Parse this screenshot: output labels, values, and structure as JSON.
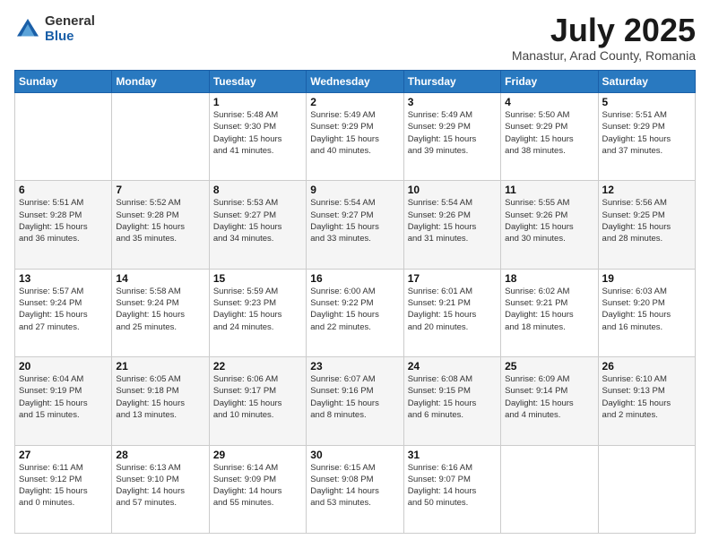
{
  "logo": {
    "general": "General",
    "blue": "Blue"
  },
  "title": "July 2025",
  "location": "Manastur, Arad County, Romania",
  "days_header": [
    "Sunday",
    "Monday",
    "Tuesday",
    "Wednesday",
    "Thursday",
    "Friday",
    "Saturday"
  ],
  "weeks": [
    [
      {
        "day": "",
        "info": ""
      },
      {
        "day": "",
        "info": ""
      },
      {
        "day": "1",
        "info": "Sunrise: 5:48 AM\nSunset: 9:30 PM\nDaylight: 15 hours\nand 41 minutes."
      },
      {
        "day": "2",
        "info": "Sunrise: 5:49 AM\nSunset: 9:29 PM\nDaylight: 15 hours\nand 40 minutes."
      },
      {
        "day": "3",
        "info": "Sunrise: 5:49 AM\nSunset: 9:29 PM\nDaylight: 15 hours\nand 39 minutes."
      },
      {
        "day": "4",
        "info": "Sunrise: 5:50 AM\nSunset: 9:29 PM\nDaylight: 15 hours\nand 38 minutes."
      },
      {
        "day": "5",
        "info": "Sunrise: 5:51 AM\nSunset: 9:29 PM\nDaylight: 15 hours\nand 37 minutes."
      }
    ],
    [
      {
        "day": "6",
        "info": "Sunrise: 5:51 AM\nSunset: 9:28 PM\nDaylight: 15 hours\nand 36 minutes."
      },
      {
        "day": "7",
        "info": "Sunrise: 5:52 AM\nSunset: 9:28 PM\nDaylight: 15 hours\nand 35 minutes."
      },
      {
        "day": "8",
        "info": "Sunrise: 5:53 AM\nSunset: 9:27 PM\nDaylight: 15 hours\nand 34 minutes."
      },
      {
        "day": "9",
        "info": "Sunrise: 5:54 AM\nSunset: 9:27 PM\nDaylight: 15 hours\nand 33 minutes."
      },
      {
        "day": "10",
        "info": "Sunrise: 5:54 AM\nSunset: 9:26 PM\nDaylight: 15 hours\nand 31 minutes."
      },
      {
        "day": "11",
        "info": "Sunrise: 5:55 AM\nSunset: 9:26 PM\nDaylight: 15 hours\nand 30 minutes."
      },
      {
        "day": "12",
        "info": "Sunrise: 5:56 AM\nSunset: 9:25 PM\nDaylight: 15 hours\nand 28 minutes."
      }
    ],
    [
      {
        "day": "13",
        "info": "Sunrise: 5:57 AM\nSunset: 9:24 PM\nDaylight: 15 hours\nand 27 minutes."
      },
      {
        "day": "14",
        "info": "Sunrise: 5:58 AM\nSunset: 9:24 PM\nDaylight: 15 hours\nand 25 minutes."
      },
      {
        "day": "15",
        "info": "Sunrise: 5:59 AM\nSunset: 9:23 PM\nDaylight: 15 hours\nand 24 minutes."
      },
      {
        "day": "16",
        "info": "Sunrise: 6:00 AM\nSunset: 9:22 PM\nDaylight: 15 hours\nand 22 minutes."
      },
      {
        "day": "17",
        "info": "Sunrise: 6:01 AM\nSunset: 9:21 PM\nDaylight: 15 hours\nand 20 minutes."
      },
      {
        "day": "18",
        "info": "Sunrise: 6:02 AM\nSunset: 9:21 PM\nDaylight: 15 hours\nand 18 minutes."
      },
      {
        "day": "19",
        "info": "Sunrise: 6:03 AM\nSunset: 9:20 PM\nDaylight: 15 hours\nand 16 minutes."
      }
    ],
    [
      {
        "day": "20",
        "info": "Sunrise: 6:04 AM\nSunset: 9:19 PM\nDaylight: 15 hours\nand 15 minutes."
      },
      {
        "day": "21",
        "info": "Sunrise: 6:05 AM\nSunset: 9:18 PM\nDaylight: 15 hours\nand 13 minutes."
      },
      {
        "day": "22",
        "info": "Sunrise: 6:06 AM\nSunset: 9:17 PM\nDaylight: 15 hours\nand 10 minutes."
      },
      {
        "day": "23",
        "info": "Sunrise: 6:07 AM\nSunset: 9:16 PM\nDaylight: 15 hours\nand 8 minutes."
      },
      {
        "day": "24",
        "info": "Sunrise: 6:08 AM\nSunset: 9:15 PM\nDaylight: 15 hours\nand 6 minutes."
      },
      {
        "day": "25",
        "info": "Sunrise: 6:09 AM\nSunset: 9:14 PM\nDaylight: 15 hours\nand 4 minutes."
      },
      {
        "day": "26",
        "info": "Sunrise: 6:10 AM\nSunset: 9:13 PM\nDaylight: 15 hours\nand 2 minutes."
      }
    ],
    [
      {
        "day": "27",
        "info": "Sunrise: 6:11 AM\nSunset: 9:12 PM\nDaylight: 15 hours\nand 0 minutes."
      },
      {
        "day": "28",
        "info": "Sunrise: 6:13 AM\nSunset: 9:10 PM\nDaylight: 14 hours\nand 57 minutes."
      },
      {
        "day": "29",
        "info": "Sunrise: 6:14 AM\nSunset: 9:09 PM\nDaylight: 14 hours\nand 55 minutes."
      },
      {
        "day": "30",
        "info": "Sunrise: 6:15 AM\nSunset: 9:08 PM\nDaylight: 14 hours\nand 53 minutes."
      },
      {
        "day": "31",
        "info": "Sunrise: 6:16 AM\nSunset: 9:07 PM\nDaylight: 14 hours\nand 50 minutes."
      },
      {
        "day": "",
        "info": ""
      },
      {
        "day": "",
        "info": ""
      }
    ]
  ]
}
